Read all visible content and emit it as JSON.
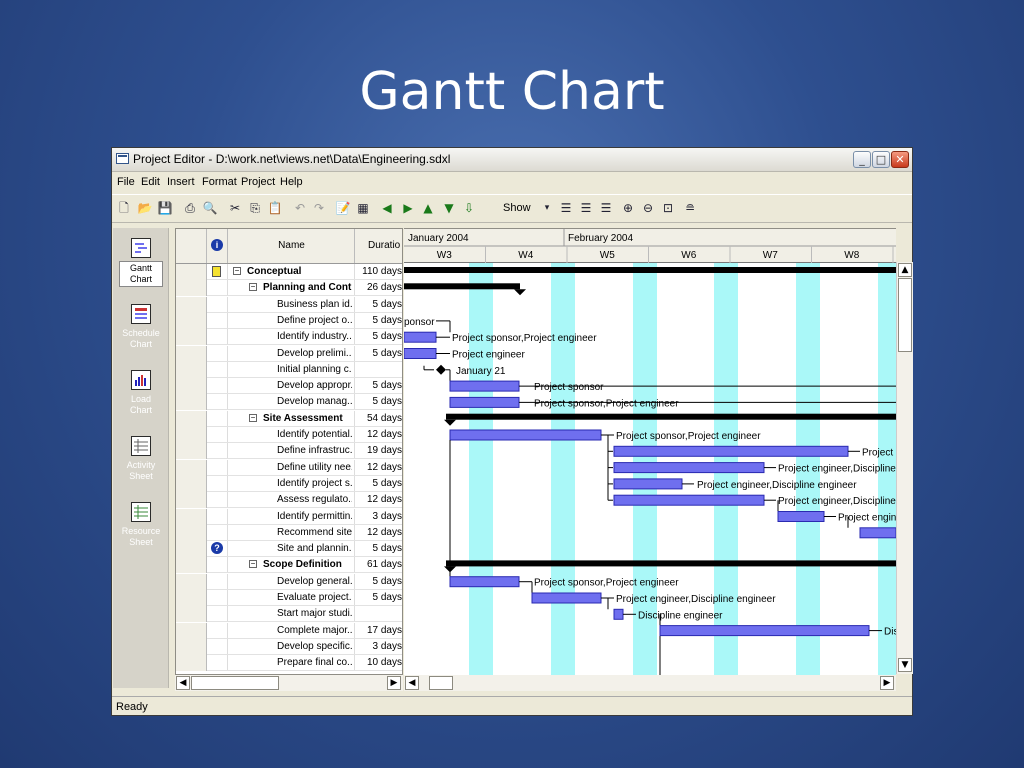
{
  "slide": {
    "title": "Gantt Chart"
  },
  "window": {
    "title": "Project Editor - D:\\work.net\\views.net\\Data\\Engineering.sdxl"
  },
  "menu": [
    "File",
    "Edit",
    "Insert",
    "Format",
    "Project",
    "Help"
  ],
  "toolbar": {
    "show_label": "Show"
  },
  "views": [
    {
      "label": "Gantt Chart",
      "active": true
    },
    {
      "label": "Schedule Chart",
      "active": false
    },
    {
      "label": "Load Chart",
      "active": false
    },
    {
      "label": "Activity Sheet",
      "active": false
    },
    {
      "label": "Resource Sheet",
      "active": false
    }
  ],
  "grid": {
    "columns": {
      "info": "i",
      "name": "Name",
      "duration": "Duratio"
    },
    "rows": [
      {
        "name": "Conceptual",
        "duration": "110 days",
        "level": 0,
        "bold": true,
        "note": true
      },
      {
        "name": "Planning and Control",
        "duration": "26 days",
        "level": 1,
        "bold": true
      },
      {
        "name": "Business plan id...",
        "duration": "5 days",
        "level": 2
      },
      {
        "name": "Define project o...",
        "duration": "5 days",
        "level": 2
      },
      {
        "name": "Identify industry...",
        "duration": "5 days",
        "level": 2
      },
      {
        "name": "Develop prelimi...",
        "duration": "5 days",
        "level": 2
      },
      {
        "name": "Initial planning c...",
        "duration": "",
        "level": 2
      },
      {
        "name": "Develop appropr...",
        "duration": "5 days",
        "level": 2
      },
      {
        "name": "Develop manag...",
        "duration": "5 days",
        "level": 2
      },
      {
        "name": "Site Assessment",
        "duration": "54 days",
        "level": 1,
        "bold": true
      },
      {
        "name": "Identify potential...",
        "duration": "12 days",
        "level": 2
      },
      {
        "name": "Define infrastruc...",
        "duration": "19 days",
        "level": 2
      },
      {
        "name": "Define utility nee...",
        "duration": "12 days",
        "level": 2
      },
      {
        "name": "Identify project s...",
        "duration": "5 days",
        "level": 2
      },
      {
        "name": "Assess regulato...",
        "duration": "12 days",
        "level": 2
      },
      {
        "name": "Identify permittin...",
        "duration": "3 days",
        "level": 2
      },
      {
        "name": "Recommend site",
        "duration": "12 days",
        "level": 2
      },
      {
        "name": "Site and plannin...",
        "duration": "5 days",
        "level": 2,
        "help": true
      },
      {
        "name": "Scope Definition",
        "duration": "61 days",
        "level": 1,
        "bold": true
      },
      {
        "name": "Develop general...",
        "duration": "5 days",
        "level": 2
      },
      {
        "name": "Evaluate project...",
        "duration": "5 days",
        "level": 2
      },
      {
        "name": "Start major studi...",
        "duration": "",
        "level": 2
      },
      {
        "name": "Complete major...",
        "duration": "17 days",
        "level": 2
      },
      {
        "name": "Develop specific...",
        "duration": "3 days",
        "level": 2
      },
      {
        "name": "Prepare final co...",
        "duration": "10 days",
        "level": 2
      }
    ]
  },
  "timeline": {
    "months": [
      "January 2004",
      "February 2004"
    ],
    "weeks": [
      "W3",
      "W4",
      "W5",
      "W6",
      "W7",
      "W8"
    ]
  },
  "bar_labels": {
    "r3": "ponsor",
    "r4": "Project sponsor,Project engineer",
    "r5": "Project engineer",
    "r6": "January 21",
    "r7": "Project sponsor",
    "r8": "Project sponsor,Project engineer",
    "r10": "Project sponsor,Project engineer",
    "r11": "Project e",
    "r12": "Project engineer,Discipline e",
    "r13": "Project engineer,Discipline engineer",
    "r14": "Project engineer,Discipline e",
    "r15": "Project engine",
    "r19": "Project sponsor,Project engineer",
    "r20": "Project engineer,Discipline engineer",
    "r21": "Discipline engineer",
    "r22": "Dis"
  },
  "status": {
    "text": "Ready"
  },
  "colors": {
    "bar": "#6f6fef",
    "weekend": "#aaf8f8",
    "summary": "#000000"
  }
}
